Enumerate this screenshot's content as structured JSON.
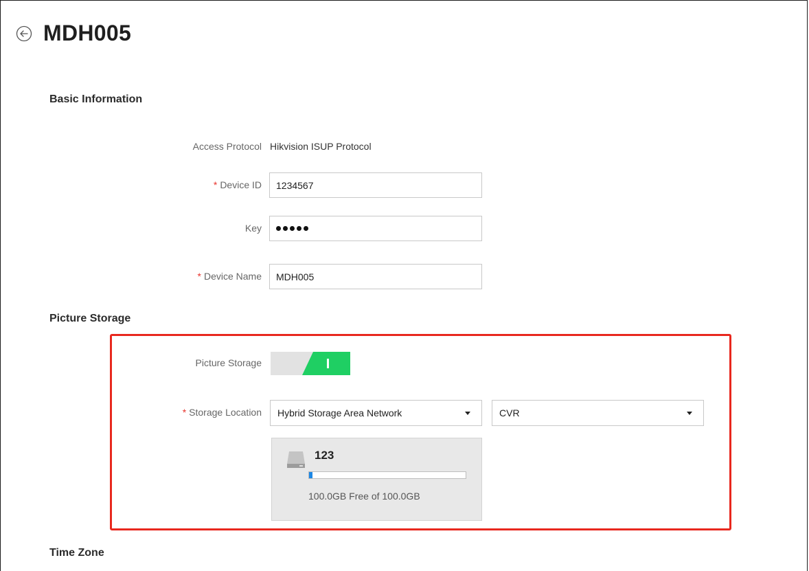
{
  "header": {
    "title": "MDH005",
    "back_icon": "back-circle-arrow-icon"
  },
  "basic_info": {
    "section_title": "Basic Information",
    "access_protocol_label": "Access Protocol",
    "access_protocol_value": "Hikvision ISUP Protocol",
    "device_id_label": "Device ID",
    "device_id_value": "1234567",
    "key_label": "Key",
    "key_masked_length": 5,
    "device_name_label": "Device Name",
    "device_name_value": "MDH005",
    "required_mark": "*"
  },
  "picture_storage": {
    "section_title": "Picture Storage",
    "toggle_label": "Picture Storage",
    "toggle_state": "on",
    "storage_location_label": "Storage Location",
    "storage_type_selected": "Hybrid Storage Area Network",
    "storage_server_selected": "CVR",
    "storage_card": {
      "name": "123",
      "icon": "hard-disk-icon",
      "capacity_text": "100.0GB Free of 100.0GB",
      "used_fraction": 0.01
    }
  },
  "time_zone": {
    "section_title": "Time Zone"
  },
  "colors": {
    "toggle_on": "#1fcf63",
    "highlight": "#e8281e",
    "required": "#e8352e",
    "progress": "#1e88e5"
  }
}
